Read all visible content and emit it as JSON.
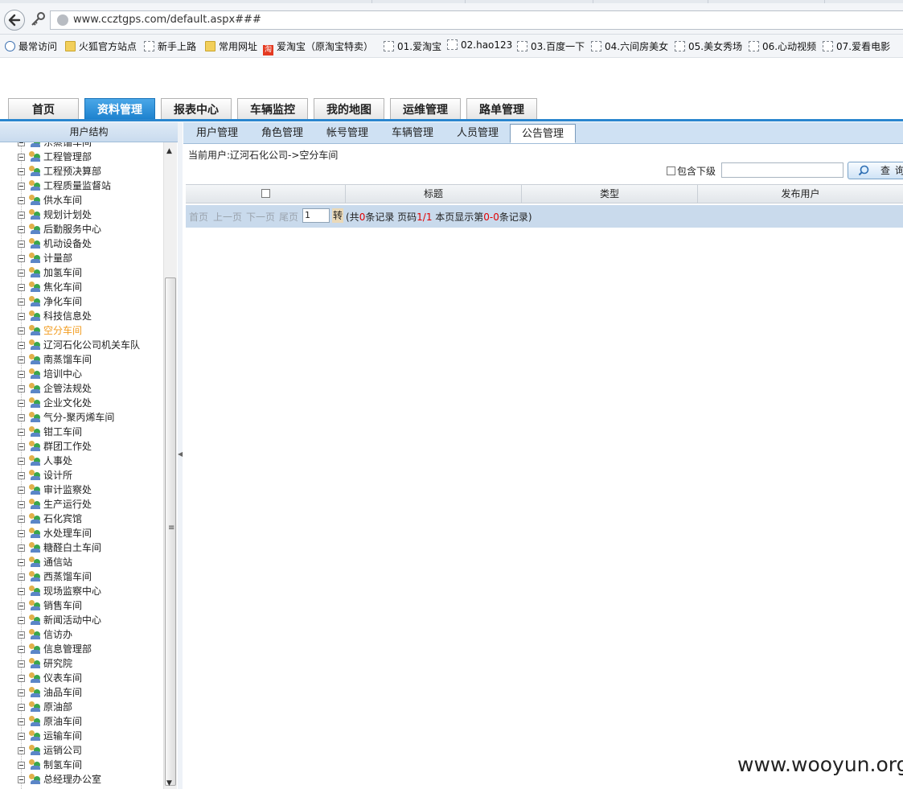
{
  "browser": {
    "url": "www.ccztgps.com/default.aspx###",
    "bookmarks": [
      "最常访问",
      "火狐官方站点",
      "新手上路",
      "常用网址",
      "爱淘宝（原淘宝特卖）",
      "01.爱淘宝",
      "02.hao123",
      "03.百度一下",
      "04.六间房美女",
      "05.美女秀场",
      "06.心动视频",
      "07.爱看电影"
    ],
    "taobao_badge": "淘"
  },
  "nav": {
    "tabs": [
      "首页",
      "资料管理",
      "报表中心",
      "车辆监控",
      "我的地图",
      "运维管理",
      "路单管理"
    ],
    "active": "资料管理"
  },
  "left": {
    "header": "用户结构",
    "items": [
      "东蒸馏车间",
      "工程管理部",
      "工程预决算部",
      "工程质量监督站",
      "供水车间",
      "规划计划处",
      "后勤服务中心",
      "机动设备处",
      "计量部",
      "加氢车间",
      "焦化车间",
      "净化车间",
      "科技信息处",
      "空分车间",
      "辽河石化公司机关车队",
      "南蒸馏车间",
      "培训中心",
      "企管法规处",
      "企业文化处",
      "气分-聚丙烯车间",
      "钳工车间",
      "群团工作处",
      "人事处",
      "设计所",
      "审计监察处",
      "生产运行处",
      "石化宾馆",
      "水处理车间",
      "糖醛白土车间",
      "通信站",
      "西蒸馏车间",
      "现场监察中心",
      "销售车间",
      "新闻活动中心",
      "信访办",
      "信息管理部",
      "研究院",
      "仪表车间",
      "油品车间",
      "原油部",
      "原油车间",
      "运输车间",
      "运销公司",
      "制氢车间",
      "总经理办公室"
    ],
    "selected": "空分车间"
  },
  "subtabs": [
    "用户管理",
    "角色管理",
    "帐号管理",
    "车辆管理",
    "人员管理",
    "公告管理"
  ],
  "subtab_active": "公告管理",
  "breadcrumb": "当前用户:辽河石化公司->空分车间",
  "filter": {
    "include_sub_label": "包含下级",
    "search_value": "",
    "query_label": "查询"
  },
  "grid": {
    "columns": [
      "标题",
      "类型",
      "发布用户"
    ]
  },
  "pager": {
    "first": "首页",
    "prev": "上一页",
    "next": "下一页",
    "last": "尾页",
    "page_input": "1",
    "go": "转",
    "info_1": "(共",
    "total": "0",
    "info_2": "条记录 页码",
    "page": "1/1",
    "info_3": " 本页显示第",
    "range": "0-0",
    "info_4": "条记录)"
  },
  "watermark": "www.wooyun.org"
}
